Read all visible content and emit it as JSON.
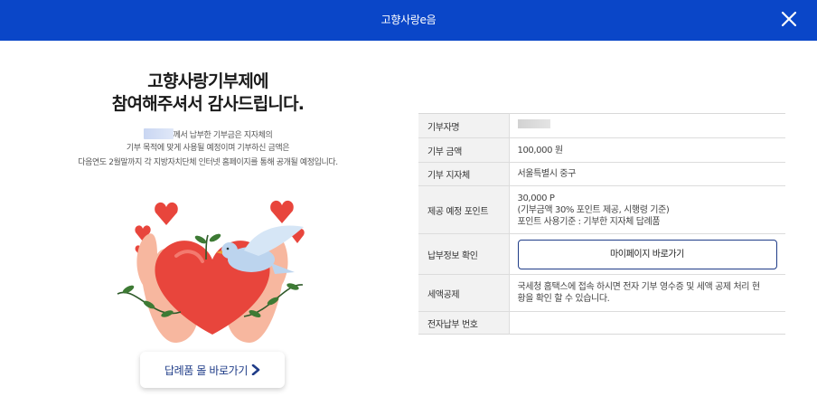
{
  "header": {
    "title": "고향사랑e음"
  },
  "main": {
    "heading_line1": "고향사랑기부제에",
    "heading_line2": "참여해주셔서 감사드립니다.",
    "desc_line1_suffix": "께서 납부한 기부금은 지자체의",
    "desc_line2": "기부 목적에 맞게 사용될 예정이며 기부하신 금액은",
    "desc_line3": "다음연도 2월말까지 각 지방자치단체 인터넷 홈페이지를 통해 공개될 예정입니다.",
    "gift_button_label": "답례품 몰 바로가기"
  },
  "table": {
    "rows": [
      {
        "label": "기부자명",
        "value": ""
      },
      {
        "label": "기부 금액",
        "value": "100,000 원"
      },
      {
        "label": "기부 지자체",
        "value": "서울특별시 중구"
      },
      {
        "label": "제공 예정 포인트",
        "lines": [
          "30,000 P",
          "(기부금액 30% 포인트 제공, 시행령 기준)",
          "포인트 사용기준 : 기부한 지자체 답례품"
        ]
      },
      {
        "label": "납부정보 확인",
        "button": "마이페이지 바로가기"
      },
      {
        "label": "세액공제",
        "lines": [
          "국세청 홈택스에 접속 하시면 전자 기부 영수증 및 세액 공제 처리 현",
          "황을 확인 할 수 있습니다."
        ]
      },
      {
        "label": "전자납부 번호",
        "value": ""
      }
    ]
  },
  "colors": {
    "header_bg": "#0a46c8",
    "accent": "#1f3c88",
    "heart": "#e8453c"
  },
  "icons": {
    "close": "close-icon",
    "gift_chevron": "chevron-right-icon"
  }
}
